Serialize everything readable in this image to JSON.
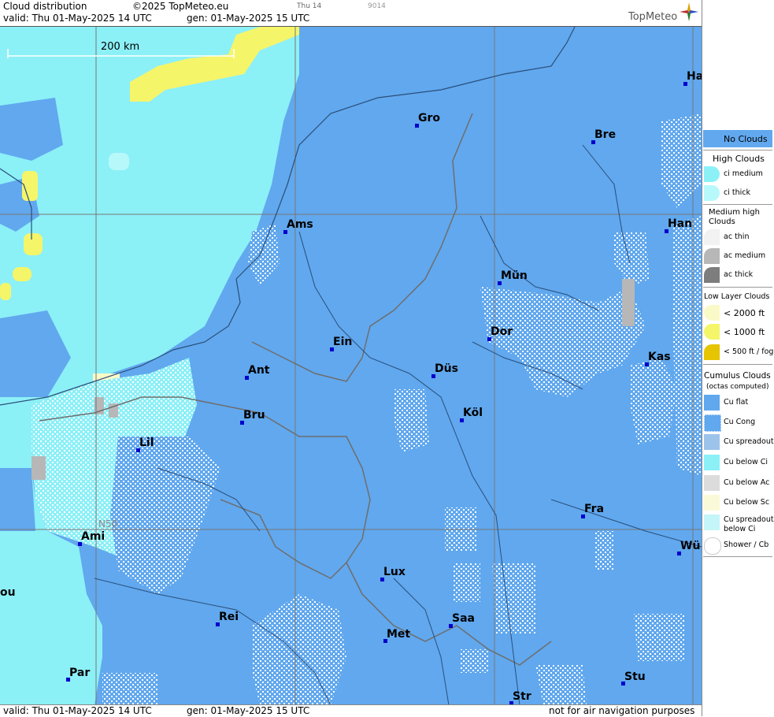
{
  "header": {
    "title": "Cloud distribution",
    "copyright": "©2025 TopMeteo.eu",
    "time_tag": "Thu 14",
    "code": "9014",
    "valid_label": "valid:  Thu  01-May-2025  14 UTC",
    "gen_label": "gen: 01-May-2025 15 UTC",
    "logo": "TopMeteo"
  },
  "footer": {
    "valid_label": "valid:  Thu  01-May-2025  14 UTC",
    "gen_label": "gen: 01-May-2025 15 UTC",
    "disclaimer": "not for air navigation purposes"
  },
  "map": {
    "scale_label": "200 km",
    "lat_label": "N50",
    "cities": [
      {
        "name": "Gro"
      },
      {
        "name": "Bre"
      },
      {
        "name": "Ha"
      },
      {
        "name": "Ams"
      },
      {
        "name": "Han"
      },
      {
        "name": "Mün"
      },
      {
        "name": "Ein"
      },
      {
        "name": "Dor"
      },
      {
        "name": "Ant"
      },
      {
        "name": "Düs"
      },
      {
        "name": "Kas"
      },
      {
        "name": "Bru"
      },
      {
        "name": "Köl"
      },
      {
        "name": "Lil"
      },
      {
        "name": "Fra"
      },
      {
        "name": "Ami"
      },
      {
        "name": "Wü"
      },
      {
        "name": "Lux"
      },
      {
        "name": "ou"
      },
      {
        "name": "Rei"
      },
      {
        "name": "Saa"
      },
      {
        "name": "Met"
      },
      {
        "name": "Par"
      },
      {
        "name": "Stu"
      },
      {
        "name": "Str"
      }
    ]
  },
  "legend": {
    "no_clouds": "No Clouds",
    "high_title": "High Clouds",
    "ci_medium": "ci medium",
    "ci_thick": "ci thick",
    "medium_title": "Medium high Clouds",
    "ac_thin": "ac thin",
    "ac_medium": "ac medium",
    "ac_thick": "ac thick",
    "low_title": "Low Layer Clouds",
    "low_2000": "< 2000 ft",
    "low_1000": "< 1000 ft",
    "low_500": "< 500 ft / fog",
    "cu_title": "Cumulus Clouds",
    "cu_sub": "(octas computed)",
    "cu_flat": "Cu flat",
    "cu_cong": "Cu Cong",
    "cu_spread": "Cu spreadout",
    "cu_below_ci": "Cu below Ci",
    "cu_below_ac": "Cu below Ac",
    "cu_below_sc": "Cu below Sc",
    "cu_spread_ci_1": "Cu spreadout",
    "cu_spread_ci_2": "below Ci",
    "shower": "Shower / Cb",
    "colors": {
      "no_clouds": "#61a8ee",
      "ci_medium": "#8cf0f7",
      "ci_thick": "#b7f8fb",
      "ac_thin": "#f2f2f2",
      "ac_medium": "#b7b7b7",
      "ac_thick": "#7d7d7d",
      "low_2000": "#fafac8",
      "low_1000": "#f5f56a",
      "low_500": "#e6c400"
    }
  }
}
